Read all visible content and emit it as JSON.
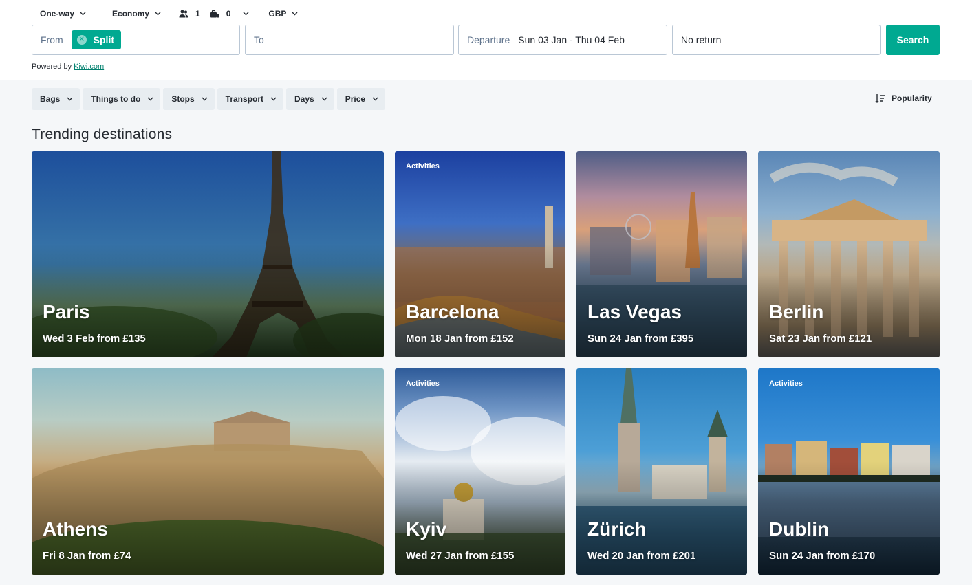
{
  "search": {
    "trip_type": "One-way",
    "cabin": "Economy",
    "passengers": "1",
    "bags": "0",
    "currency": "GBP",
    "from_label": "From",
    "from_chip": "Split",
    "to_placeholder": "To",
    "departure_label": "Departure",
    "departure_value": "Sun 03 Jan -  Thu 04 Feb",
    "return_value": "No return",
    "search_button": "Search",
    "powered_prefix": "Powered by",
    "powered_link": "Kiwi.com"
  },
  "filters": [
    {
      "label": "Bags"
    },
    {
      "label": "Things to do"
    },
    {
      "label": "Stops"
    },
    {
      "label": "Transport"
    },
    {
      "label": "Days"
    },
    {
      "label": "Price"
    }
  ],
  "sort": {
    "label": "Popularity"
  },
  "section_title": "Trending destinations",
  "destinations": [
    {
      "city": "Paris",
      "subtitle": "Wed 3 Feb from £135",
      "tag": ""
    },
    {
      "city": "Barcelona",
      "subtitle": "Mon 18 Jan from £152",
      "tag": "Activities"
    },
    {
      "city": "Las Vegas",
      "subtitle": "Sun 24 Jan from £395",
      "tag": ""
    },
    {
      "city": "Berlin",
      "subtitle": "Sat 23 Jan from £121",
      "tag": ""
    },
    {
      "city": "Athens",
      "subtitle": "Fri 8 Jan from £74",
      "tag": ""
    },
    {
      "city": "Kyiv",
      "subtitle": "Wed 27 Jan from £155",
      "tag": "Activities"
    },
    {
      "city": "Zürich",
      "subtitle": "Wed 20 Jan from £201",
      "tag": ""
    },
    {
      "city": "Dublin",
      "subtitle": "Sun 24 Jan from £170",
      "tag": "Activities"
    }
  ],
  "colors": {
    "brand": "#00a991",
    "link": "#00806e"
  },
  "icons": {
    "passenger": "passenger-icon",
    "bag": "bag-icon",
    "sort": "sort-icon",
    "chevron": "chevron-down-icon",
    "clear": "close-icon"
  }
}
